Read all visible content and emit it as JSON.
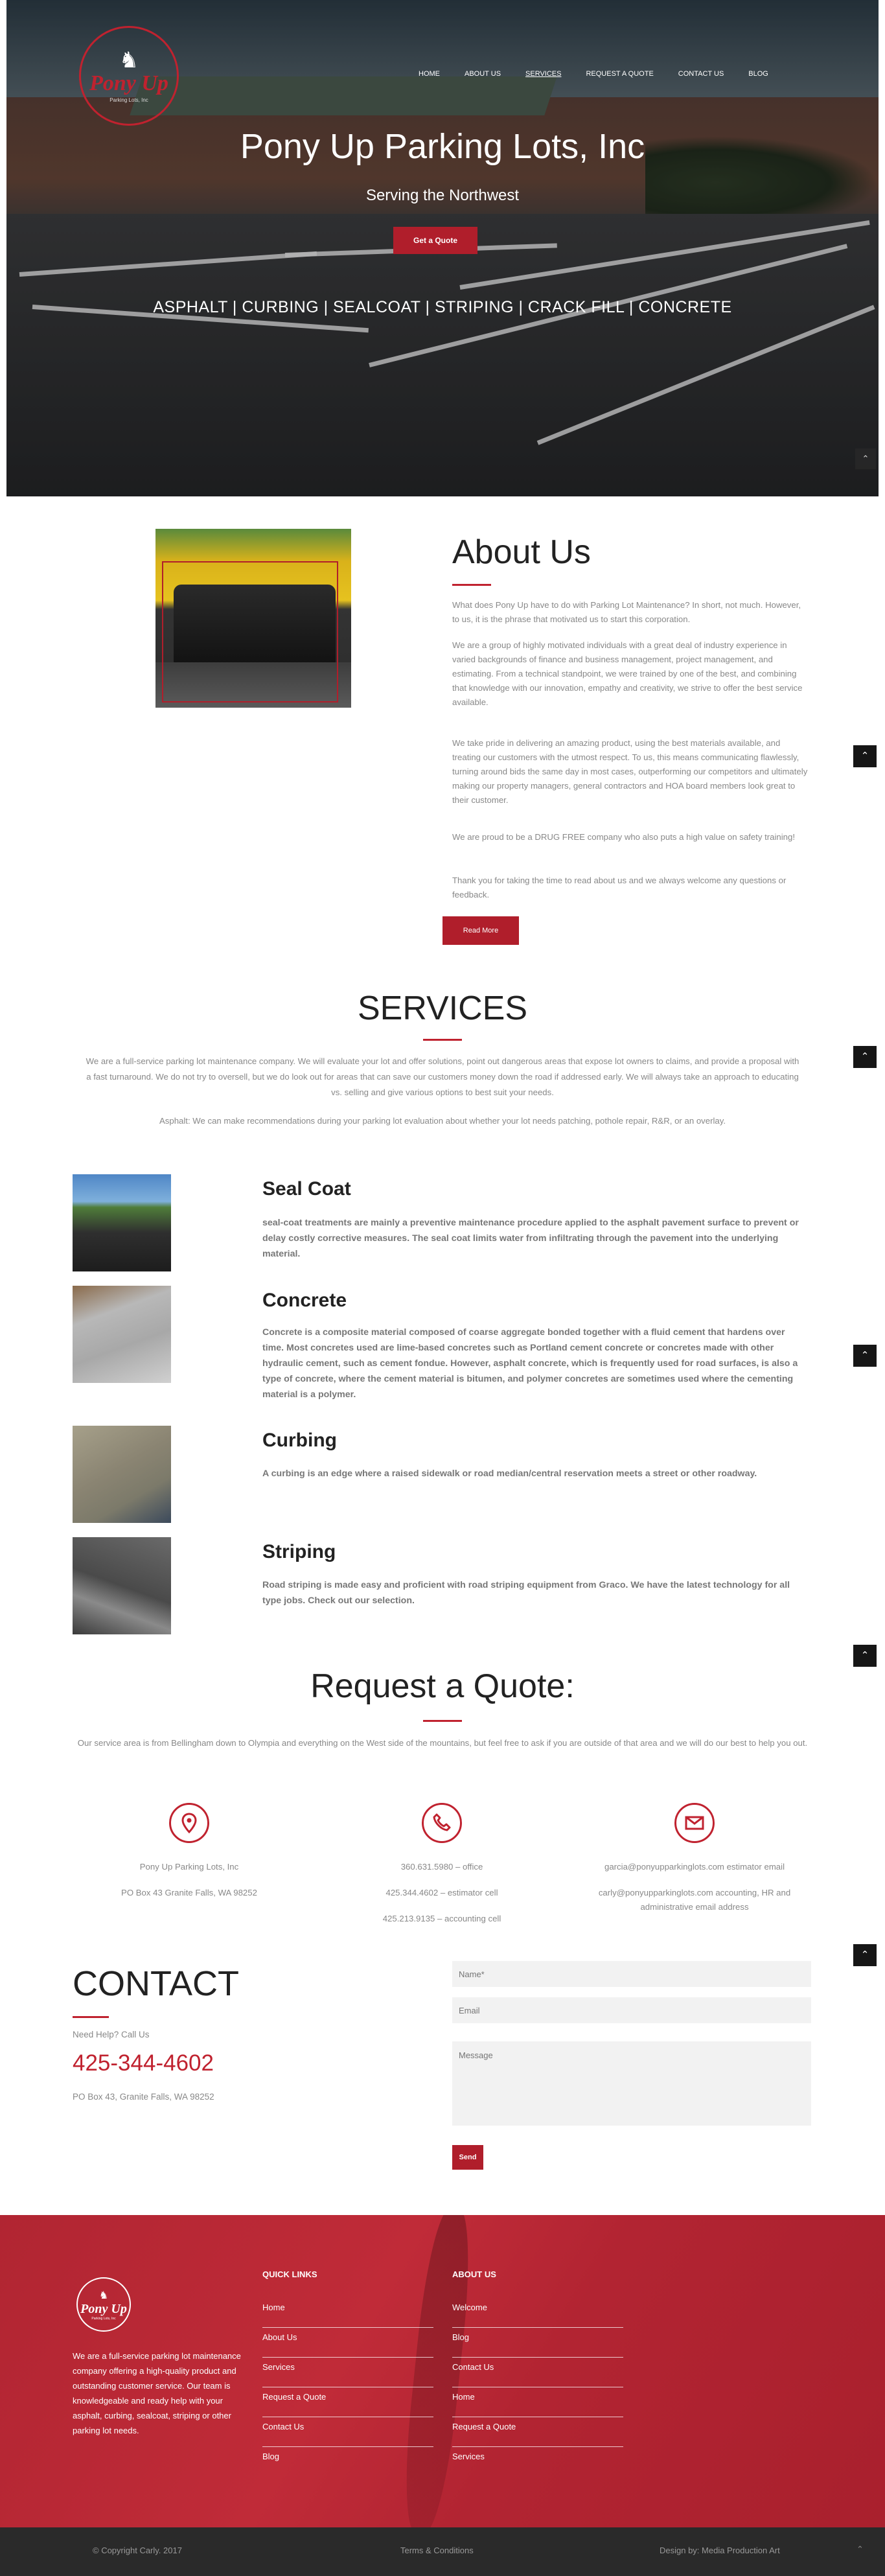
{
  "logo": {
    "icon": "horse-head-icon",
    "brand": "Pony Up",
    "sub": "Parking Lots, Inc"
  },
  "nav": [
    {
      "label": "HOME"
    },
    {
      "label": "ABOUT US"
    },
    {
      "label": "SERVICES"
    },
    {
      "label": "REQUEST A QUOTE"
    },
    {
      "label": "CONTACT US"
    },
    {
      "label": "BLOG"
    }
  ],
  "hero": {
    "title": "Pony Up Parking Lots, Inc",
    "subtitle": "Serving the Northwest",
    "button": "Get a Quote",
    "services_line": "ASPHALT | CURBING | SEALCOAT | STRIPING | CRACK FILL | CONCRETE"
  },
  "scroll_top": {
    "icon": "chevron-up-icon",
    "glyph": "⌃"
  },
  "about": {
    "title": "About Us",
    "paragraphs": [
      "What does Pony Up have to do with Parking Lot Maintenance? In short, not much. However, to us, it is the phrase that motivated us to start this corporation.",
      "We are a group of highly motivated individuals with a great deal of industry experience in varied backgrounds of finance and business management, project management, and estimating. From a technical standpoint, we were trained by one of the best, and combining that knowledge with our innovation, empathy and creativity, we strive to offer the best service available.",
      "We take pride in delivering an amazing product, using the best materials available, and treating our customers with the utmost respect. To us, this means communicating flawlessly, turning around bids the same day in most cases, outperforming our competitors and ultimately making our property managers, general contractors and HOA board members look great to their customer.",
      "We are proud to be a DRUG FREE company who also puts a high value on safety training!",
      "Thank you for taking the time to read about us and we always welcome any questions or feedback."
    ],
    "button": "Read More"
  },
  "services": {
    "title": "SERVICES",
    "intro": "We are a full-service parking lot maintenance company. We will evaluate your lot and offer solutions, point out dangerous areas that expose lot owners to claims, and provide a proposal with a fast turnaround. We do not try to oversell, but we do look out for areas that can save our customers money down the road if addressed early. We will always take an approach to educating vs. selling and give various options to best suit your needs.",
    "asphalt": "Asphalt: We can make recommendations during your parking lot evaluation about whether your lot needs patching, pothole repair, R&R, or an overlay.",
    "items": [
      {
        "name": "Seal Coat",
        "desc": "seal-coat treatments are mainly a preventive maintenance procedure applied to the asphalt pavement surface to prevent or delay costly corrective measures. The seal coat limits water from infiltrating through the pavement into the underlying material."
      },
      {
        "name": "Concrete",
        "desc": "Concrete is a composite material composed of coarse aggregate bonded together with a fluid cement that hardens over time. Most concretes used are lime-based concretes such as Portland cement concrete or concretes made with other hydraulic cement, such as cement fondue. However, asphalt concrete, which is frequently used for road surfaces, is also a type of concrete, where the cement material is bitumen, and polymer concretes are sometimes used where the cementing material is a polymer."
      },
      {
        "name": "Curbing",
        "desc": "A curbing is an edge where a raised sidewalk or road median/central reservation meets a street or other roadway."
      },
      {
        "name": "Striping",
        "desc": "Road striping is made easy and proficient with road striping equipment from Graco. We have the latest technology for all type jobs. Check out our selection."
      }
    ]
  },
  "quote": {
    "title": "Request a Quote:",
    "text": "Our service area is from Bellingham down to Olympia and everything on the West side of the mountains, but feel free to ask if you are outside of that area and we will do our best to help you out.",
    "columns": [
      {
        "icon": "map-pin-icon",
        "lines": [
          "Pony Up Parking Lots, Inc",
          "PO Box 43 Granite Falls, WA 98252"
        ]
      },
      {
        "icon": "phone-icon",
        "lines": [
          "360.631.5980 – office",
          "425.344.4602 – estimator cell",
          "425.213.9135 – accounting cell"
        ]
      },
      {
        "icon": "mail-icon",
        "lines": [
          "garcia@ponyupparkinglots.com estimator email",
          "carly@ponyupparkinglots.com accounting, HR and administrative email address"
        ]
      }
    ]
  },
  "contact": {
    "title": "CONTACT",
    "help": "Need Help? Call Us",
    "phone": "425-344-4602",
    "address": "PO Box 43, Granite Falls, WA 98252",
    "name_placeholder": "Name*",
    "email_placeholder": "Email",
    "message_placeholder": "Message",
    "send": "Send"
  },
  "footer": {
    "about": "We are a full-service parking lot maintenance company offering a high-quality product and outstanding customer service. Our team is knowledgeable and ready help with your asphalt, curbing, sealcoat, striping or other parking lot needs.",
    "quick_links_title": "QUICK LINKS",
    "quick_links": [
      "Home",
      "About Us",
      "Services",
      "Request a Quote",
      "Contact Us",
      "Blog"
    ],
    "about_us_title": "ABOUT US",
    "about_links": [
      "Welcome",
      "Blog",
      "Contact Us",
      "Home",
      "Request a Quote",
      "Services"
    ]
  },
  "bottom": {
    "copyright": "© Copyright Carly. 2017",
    "terms": "Terms & Conditions",
    "design": "Design by: Media Production Art"
  },
  "colors": {
    "accent": "#c0222f",
    "footer_bg": "#b8232f",
    "bottom_bg": "#2a2a2a"
  }
}
